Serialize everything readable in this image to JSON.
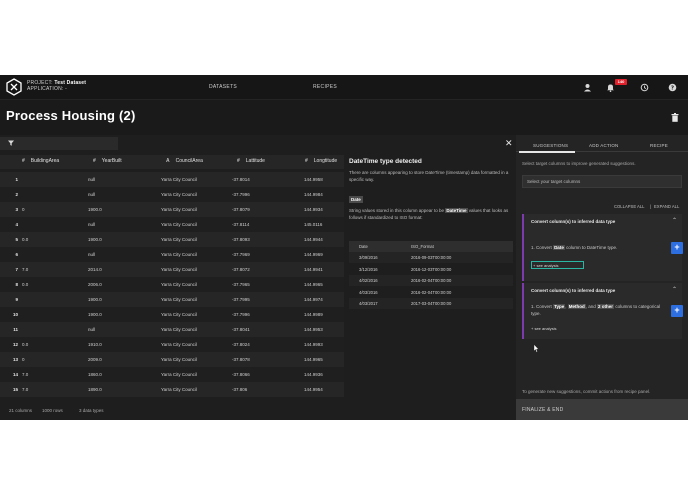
{
  "header": {
    "project_label": "PROJECT:",
    "project_name": "Test Dataset",
    "application_label": "APPLICATION: -",
    "nav": [
      "DATASETS",
      "RECIPES"
    ],
    "notification_count": "140"
  },
  "page": {
    "title": "Process Housing (2)"
  },
  "table": {
    "columns": [
      {
        "symbol": "#",
        "name": "BuildingArea"
      },
      {
        "symbol": "#",
        "name": "YearBuilt"
      },
      {
        "symbol": "A",
        "name": "CouncilArea"
      },
      {
        "symbol": "#",
        "name": "Lattitude"
      },
      {
        "symbol": "#",
        "name": "Longtitude"
      }
    ],
    "rows": [
      {
        "idx": "1",
        "ba": "",
        "yb": "null",
        "ca": "Yarra City Council",
        "lat": "-37.8014",
        "lon": "144.9958"
      },
      {
        "idx": "2",
        "ba": "",
        "yb": "null",
        "ca": "Yarra City Council",
        "lat": "-37.7996",
        "lon": "144.9984"
      },
      {
        "idx": "3",
        "ba": "0",
        "yb": "1900.0",
        "ca": "Yarra City Council",
        "lat": "-37.8079",
        "lon": "144.9934"
      },
      {
        "idx": "4",
        "ba": "",
        "yb": "null",
        "ca": "Yarra City Council",
        "lat": "-37.8114",
        "lon": "145.0116"
      },
      {
        "idx": "5",
        "ba": "0.0",
        "yb": "1900.0",
        "ca": "Yarra City Council",
        "lat": "-37.8093",
        "lon": "144.9944"
      },
      {
        "idx": "6",
        "ba": "",
        "yb": "null",
        "ca": "Yarra City Council",
        "lat": "-37.7969",
        "lon": "144.9969"
      },
      {
        "idx": "7",
        "ba": "7.0",
        "yb": "2014.0",
        "ca": "Yarra City Council",
        "lat": "-37.8072",
        "lon": "144.9941"
      },
      {
        "idx": "8",
        "ba": "0.0",
        "yb": "2006.0",
        "ca": "Yarra City Council",
        "lat": "-37.7965",
        "lon": "144.9965"
      },
      {
        "idx": "9",
        "ba": "",
        "yb": "1900.0",
        "ca": "Yarra City Council",
        "lat": "-37.7995",
        "lon": "144.9974"
      },
      {
        "idx": "10",
        "ba": "",
        "yb": "1900.0",
        "ca": "Yarra City Council",
        "lat": "-37.7996",
        "lon": "144.9989"
      },
      {
        "idx": "11",
        "ba": "",
        "yb": "null",
        "ca": "Yarra City Council",
        "lat": "-37.8041",
        "lon": "144.9953"
      },
      {
        "idx": "12",
        "ba": "0.0",
        "yb": "1910.0",
        "ca": "Yarra City Council",
        "lat": "-37.8024",
        "lon": "144.9993"
      },
      {
        "idx": "13",
        "ba": "0",
        "yb": "2009.0",
        "ca": "Yarra City Council",
        "lat": "-37.8078",
        "lon": "144.9965"
      },
      {
        "idx": "14",
        "ba": "7.0",
        "yb": "1860.0",
        "ca": "Yarra City Council",
        "lat": "-37.8066",
        "lon": "144.9936"
      },
      {
        "idx": "15",
        "ba": "7.0",
        "yb": "1890.0",
        "ca": "Yarra City Council",
        "lat": "-37.806",
        "lon": "144.9954"
      }
    ],
    "footer": [
      "21 columns",
      "1000 rows",
      "3 data types"
    ]
  },
  "detail": {
    "title": "DateTime type detected",
    "desc": "There are columns appearing to store DateTime (timestamp) data formatted in a specific way.",
    "tag": "Date",
    "note_pre": "String values stored in this column appear to be",
    "note_hl": "DateTime",
    "note_post": "values that looks as follows if standardized to ISO format:",
    "table_headers": [
      "Date",
      "ISO_Format"
    ],
    "table_rows": [
      [
        "3/09/2016",
        "2016-09-03T00:00:00"
      ],
      [
        "3/12/2016",
        "2016-12-03T00:00:00"
      ],
      [
        "4/02/2016",
        "2016-02-04T00:00:00"
      ],
      [
        "4/03/2016",
        "2016-02-04T00:00:00"
      ],
      [
        "4/03/2017",
        "2017-03-04T00:00:00"
      ]
    ]
  },
  "right": {
    "tabs": [
      "SUGGESTIONS",
      "ADD ACTION",
      "RECIPE"
    ],
    "desc": "Select target columns to improve generated suggestions.",
    "select_placeholder": "Select your target columns",
    "collapse_all": "COLLAPSE ALL",
    "separator": "|",
    "expand_all": "EXPAND ALL",
    "card1": {
      "title": "Convert column(s) to inferred data type",
      "num": "1.",
      "pre": "Convert",
      "hl": "Date",
      "post": "column to DateTime type.",
      "see": "+ see analysis"
    },
    "card2": {
      "title": "Convert column(s) to inferred data type",
      "num": "1.",
      "pre": "Convert",
      "hl1": "Type",
      "sep": ",",
      "hl2": "Method",
      "mid": ", and",
      "hl3": "2 other",
      "post": "columns to categorical type.",
      "see": "+ see analysis"
    },
    "hint": "To generate new suggestions, commit actions from recipe panel.",
    "finalize": "FINALIZE & END"
  }
}
